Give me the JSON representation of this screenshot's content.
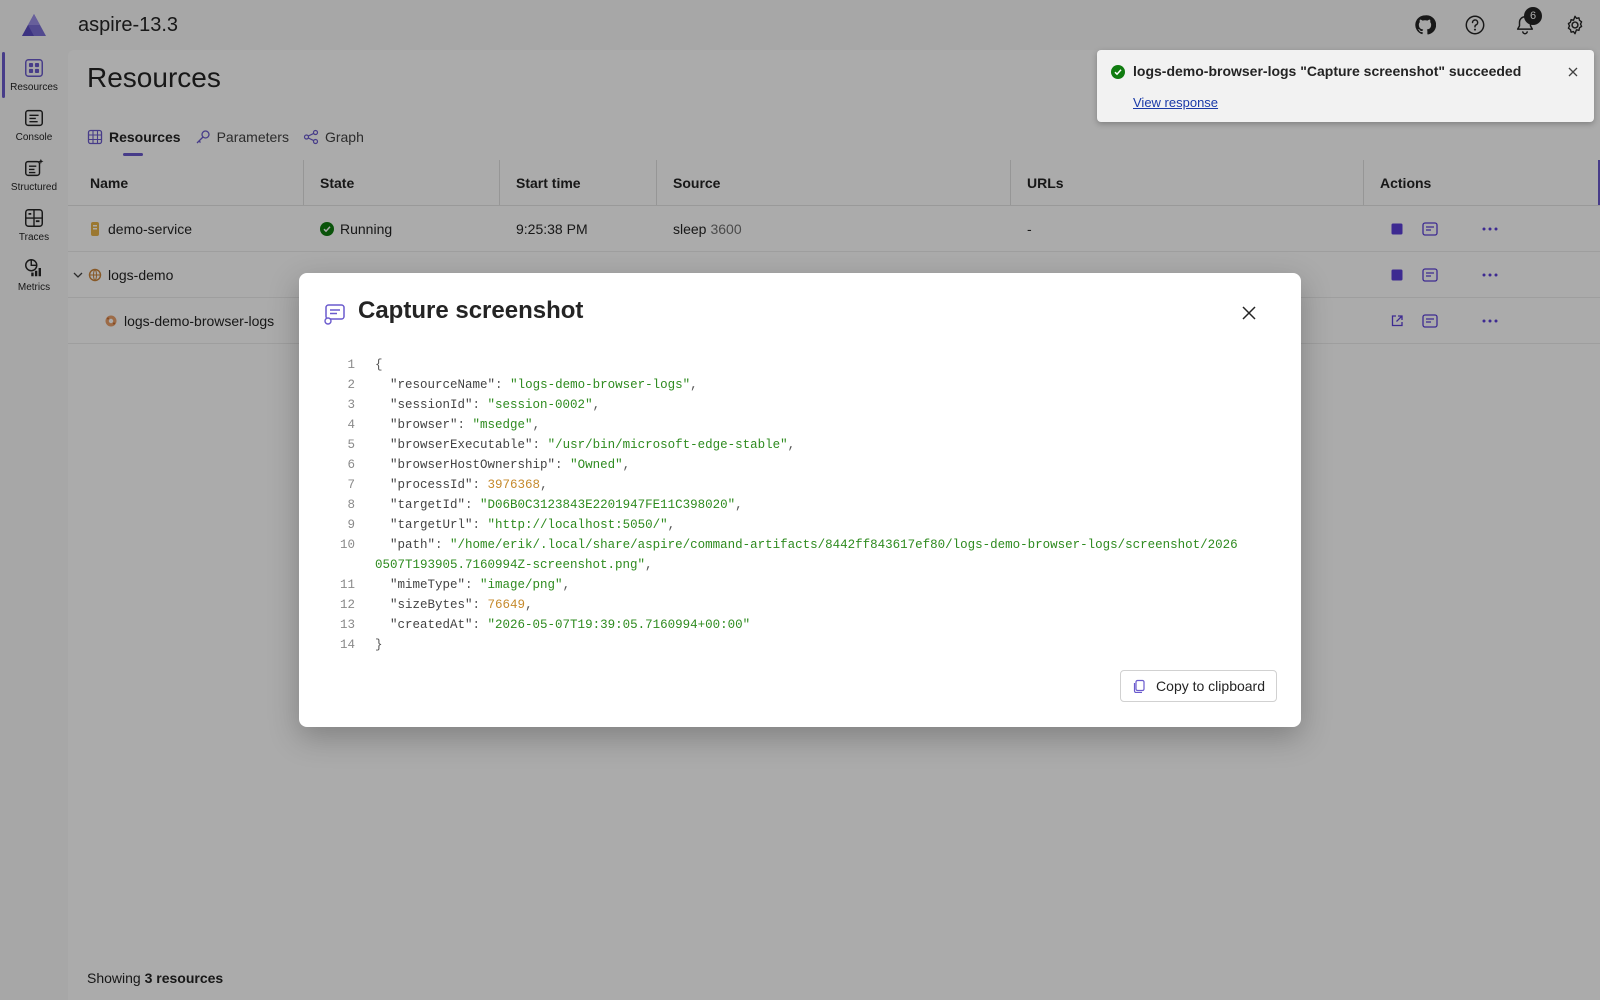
{
  "app": {
    "title": "aspire-13.3",
    "notification_count": "6"
  },
  "sidebar": {
    "items": [
      {
        "label": "Resources",
        "icon": "grid-icon",
        "active": true
      },
      {
        "label": "Console",
        "icon": "console-icon"
      },
      {
        "label": "Structured",
        "icon": "structured-logs-icon"
      },
      {
        "label": "Traces",
        "icon": "traces-icon"
      },
      {
        "label": "Metrics",
        "icon": "metrics-icon"
      }
    ]
  },
  "main": {
    "title": "Resources",
    "tabs": [
      {
        "label": "Resources",
        "icon": "table-icon"
      },
      {
        "label": "Parameters",
        "icon": "key-icon"
      },
      {
        "label": "Graph",
        "icon": "graph-icon"
      }
    ],
    "columns": [
      "Name",
      "State",
      "Start time",
      "Source",
      "URLs",
      "Actions"
    ],
    "rows": [
      {
        "name": "demo-service",
        "state": "Running",
        "start": "9:25:38 PM",
        "source": "sleep",
        "source_arg": "3600",
        "urls": "-"
      },
      {
        "name": "logs-demo"
      },
      {
        "name": "logs-demo-browser-logs"
      }
    ],
    "footer_prefix": "Showing ",
    "footer_count": "3 resources"
  },
  "toast": {
    "title": "logs-demo-browser-logs \"Capture screenshot\" succeeded",
    "link": "View response"
  },
  "dialog": {
    "title": "Capture screenshot",
    "copy_label": "Copy to clipboard",
    "lines": [
      {
        "n": "1",
        "parts": [
          [
            "p",
            "{"
          ]
        ]
      },
      {
        "n": "2",
        "parts": [
          [
            "k",
            "  \"resourceName\""
          ],
          [
            "p",
            ": "
          ],
          [
            "s",
            "\"logs-demo-browser-logs\""
          ],
          [
            "p",
            ","
          ]
        ]
      },
      {
        "n": "3",
        "parts": [
          [
            "k",
            "  \"sessionId\""
          ],
          [
            "p",
            ": "
          ],
          [
            "s",
            "\"session-0002\""
          ],
          [
            "p",
            ","
          ]
        ]
      },
      {
        "n": "4",
        "parts": [
          [
            "k",
            "  \"browser\""
          ],
          [
            "p",
            ": "
          ],
          [
            "s",
            "\"msedge\""
          ],
          [
            "p",
            ","
          ]
        ]
      },
      {
        "n": "5",
        "parts": [
          [
            "k",
            "  \"browserExecutable\""
          ],
          [
            "p",
            ": "
          ],
          [
            "s",
            "\"/usr/bin/microsoft-edge-stable\""
          ],
          [
            "p",
            ","
          ]
        ]
      },
      {
        "n": "6",
        "parts": [
          [
            "k",
            "  \"browserHostOwnership\""
          ],
          [
            "p",
            ": "
          ],
          [
            "s",
            "\"Owned\""
          ],
          [
            "p",
            ","
          ]
        ]
      },
      {
        "n": "7",
        "parts": [
          [
            "k",
            "  \"processId\""
          ],
          [
            "p",
            ": "
          ],
          [
            "n",
            "3976368"
          ],
          [
            "p",
            ","
          ]
        ]
      },
      {
        "n": "8",
        "parts": [
          [
            "k",
            "  \"targetId\""
          ],
          [
            "p",
            ": "
          ],
          [
            "s",
            "\"D06B0C3123843E2201947FE11C398020\""
          ],
          [
            "p",
            ","
          ]
        ]
      },
      {
        "n": "9",
        "parts": [
          [
            "k",
            "  \"targetUrl\""
          ],
          [
            "p",
            ": "
          ],
          [
            "s",
            "\"http://localhost:5050/\""
          ],
          [
            "p",
            ","
          ]
        ]
      },
      {
        "n": "10",
        "parts": [
          [
            "k",
            "  \"path\""
          ],
          [
            "p",
            ": "
          ],
          [
            "s",
            "\"/home/erik/.local/share/aspire/command-artifacts/8442ff843617ef80/logs-demo-browser-logs/screenshot/20260507T193905.7160994Z-screenshot.png\""
          ],
          [
            "p",
            ","
          ]
        ]
      },
      {
        "n": "11",
        "parts": [
          [
            "k",
            "  \"mimeType\""
          ],
          [
            "p",
            ": "
          ],
          [
            "s",
            "\"image/png\""
          ],
          [
            "p",
            ","
          ]
        ]
      },
      {
        "n": "12",
        "parts": [
          [
            "k",
            "  \"sizeBytes\""
          ],
          [
            "p",
            ": "
          ],
          [
            "n",
            "76649"
          ],
          [
            "p",
            ","
          ]
        ]
      },
      {
        "n": "13",
        "parts": [
          [
            "k",
            "  \"createdAt\""
          ],
          [
            "p",
            ": "
          ],
          [
            "s",
            "\"2026-05-07T19:39:05.7160994+00:00\""
          ]
        ]
      },
      {
        "n": "14",
        "parts": [
          [
            "p",
            "}"
          ]
        ]
      }
    ]
  },
  "colors": {
    "accent": "#6a5acd",
    "success": "#107c10",
    "string": "#2e8b1f",
    "number": "#c58a2c"
  }
}
